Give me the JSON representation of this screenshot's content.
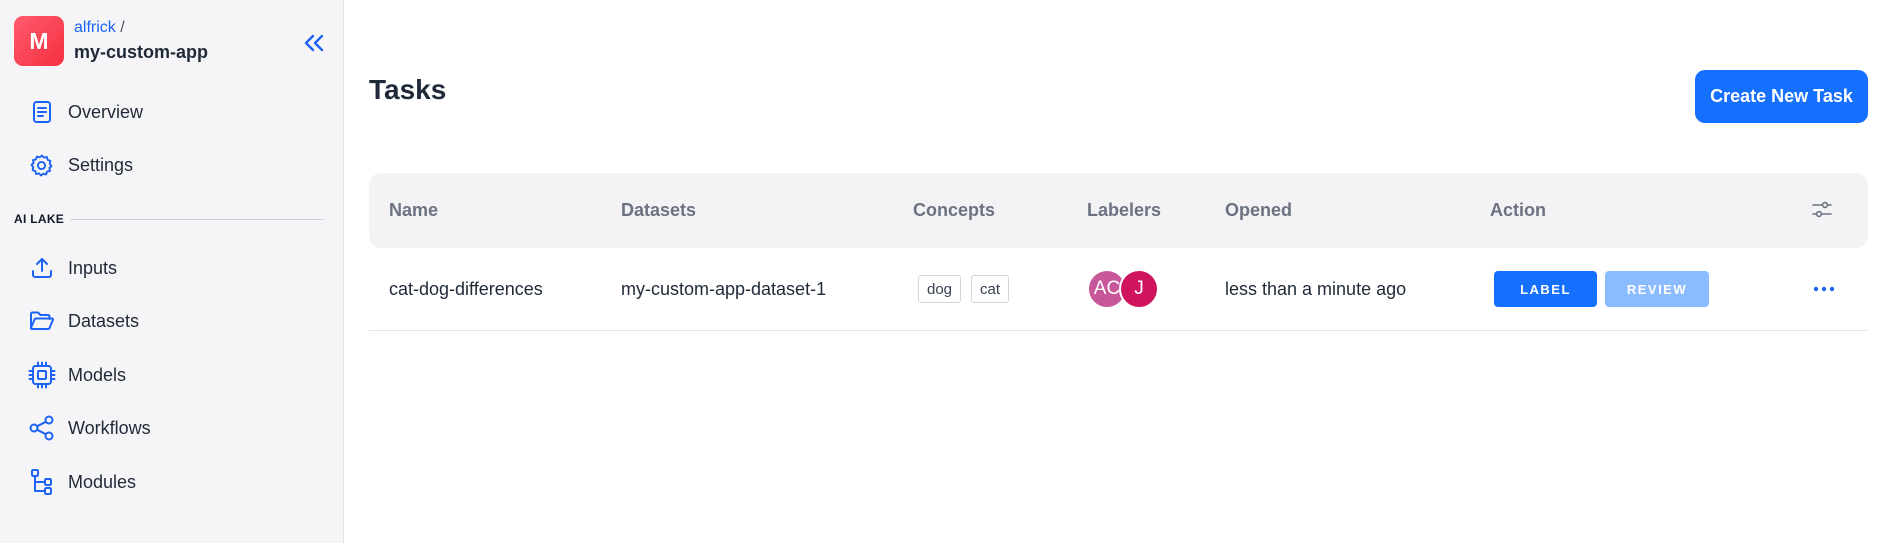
{
  "app": {
    "avatar_letter": "M",
    "owner": "alfrick",
    "separator": "/",
    "name": "my-custom-app"
  },
  "sidebar": {
    "top_items": [
      {
        "label": "Overview",
        "icon": "document-icon"
      },
      {
        "label": "Settings",
        "icon": "gear-icon"
      }
    ],
    "section_label": "AI LAKE",
    "lake_items": [
      {
        "label": "Inputs",
        "icon": "upload-icon"
      },
      {
        "label": "Datasets",
        "icon": "folder-open-icon"
      },
      {
        "label": "Models",
        "icon": "chip-icon"
      },
      {
        "label": "Workflows",
        "icon": "share-nodes-icon"
      },
      {
        "label": "Modules",
        "icon": "tree-icon"
      }
    ]
  },
  "main": {
    "title": "Tasks",
    "create_button": "Create New Task"
  },
  "table": {
    "headers": [
      "Name",
      "Datasets",
      "Concepts",
      "Labelers",
      "Opened",
      "Action"
    ],
    "rows": [
      {
        "name": "cat-dog-differences",
        "dataset": "my-custom-app-dataset-1",
        "concepts": [
          "dog",
          "cat"
        ],
        "labelers": [
          {
            "initials": "AC",
            "color": "#c8579a"
          },
          {
            "initials": "J",
            "color": "#d0155e"
          }
        ],
        "opened": "less than a minute ago",
        "actions": {
          "label": "LABEL",
          "review": "REVIEW"
        }
      }
    ]
  },
  "colors": {
    "accent": "#1570ff",
    "accent_light": "#8bbcff",
    "icon_blue": "#1d63f5",
    "sidebar_bg": "#f5f5f7"
  }
}
